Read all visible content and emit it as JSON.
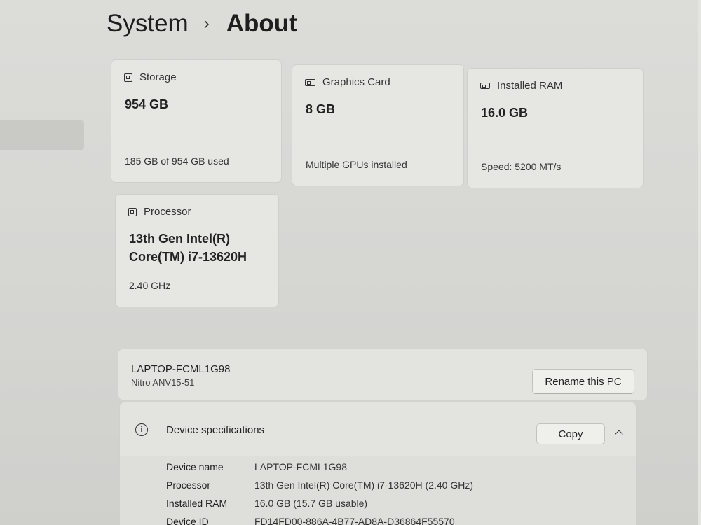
{
  "breadcrumb": {
    "parent": "System",
    "separator": "›",
    "current": "About"
  },
  "cards": {
    "storage": {
      "title": "Storage",
      "value": "954 GB",
      "sub": "185 GB of 954 GB used"
    },
    "gpu": {
      "title": "Graphics Card",
      "value": "8 GB",
      "sub": "Multiple GPUs installed"
    },
    "ram": {
      "title": "Installed RAM",
      "value": "16.0 GB",
      "sub": "Speed: 5200 MT/s"
    },
    "processor": {
      "title": "Processor",
      "value": "13th Gen Intel(R) Core(TM) i7-13620H",
      "sub": "2.40 GHz"
    }
  },
  "device": {
    "name": "LAPTOP-FCML1G98",
    "model": "Nitro ANV15-51",
    "rename_label": "Rename this PC"
  },
  "specs": {
    "title": "Device specifications",
    "copy_label": "Copy",
    "rows": [
      {
        "label": "Device name",
        "value": "LAPTOP-FCML1G98"
      },
      {
        "label": "Processor",
        "value": "13th Gen Intel(R) Core(TM) i7-13620H (2.40 GHz)"
      },
      {
        "label": "Installed RAM",
        "value": "16.0 GB (15.7 GB usable)"
      },
      {
        "label": "Device ID",
        "value": "FD14FD00-886A-4B77-AD8A-D36864F55570"
      }
    ]
  }
}
